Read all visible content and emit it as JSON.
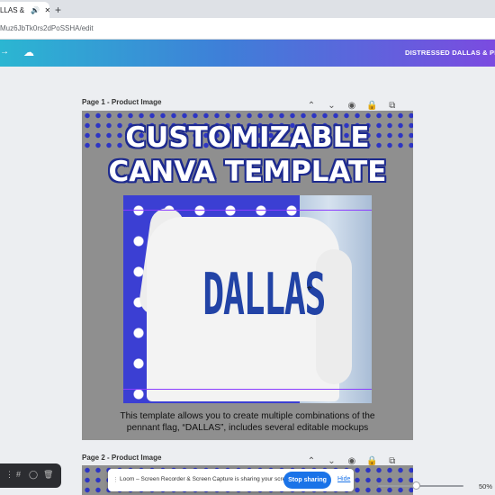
{
  "browser": {
    "tab_title": "LLAS & PEN",
    "tab_audio_icon": "speaker-icon",
    "tab_close_icon": "close-icon",
    "new_tab_label": "+",
    "url": "Muz6JbTk0rs2dPoSSHA/edit"
  },
  "canva_toolbar": {
    "left_icon": "arrow-icon",
    "cloud_icon": "cloud-check-icon",
    "document_title": "DISTRESSED DALLAS & PENN"
  },
  "pages": [
    {
      "label": "Page 1 - Product Image",
      "tools": [
        "^",
        "v",
        "◉",
        "⌂",
        "⧉",
        "⌫",
        "↗"
      ],
      "headline_line1": "CUSTOMIZABLE",
      "headline_line2": "CANVA TEMPLATE",
      "mockup_text": "DALLAS",
      "mockup_sleeve_text": "DALLAS",
      "caption_line1": "This template allows you to create multiple combinations of the",
      "caption_line2": "pennant flag, “DALLAS”, includes several editable mockups"
    },
    {
      "label": "Page 2 - Product Image",
      "tools": [
        "^",
        "v",
        "◉",
        "⌂",
        "⧉",
        "⌫",
        "↗"
      ]
    }
  ],
  "loom": {
    "grip_icon": "grip-icon",
    "message": "Loom – Screen Recorder & Screen Capture is sharing your screen.",
    "stop_label": "Stop sharing",
    "hide_label": "Hide"
  },
  "dock": {
    "icons": [
      "grid-icon",
      "hash-icon",
      "circle-icon",
      "trash-icon"
    ]
  },
  "zoom": {
    "value_label": "50%",
    "level": 0.5
  },
  "colors": {
    "canva_gradient_start": "#2bb6d2",
    "canva_gradient_end": "#7b4be0",
    "star_blue": "#3b3fd3",
    "stop_button": "#1a73e8"
  }
}
